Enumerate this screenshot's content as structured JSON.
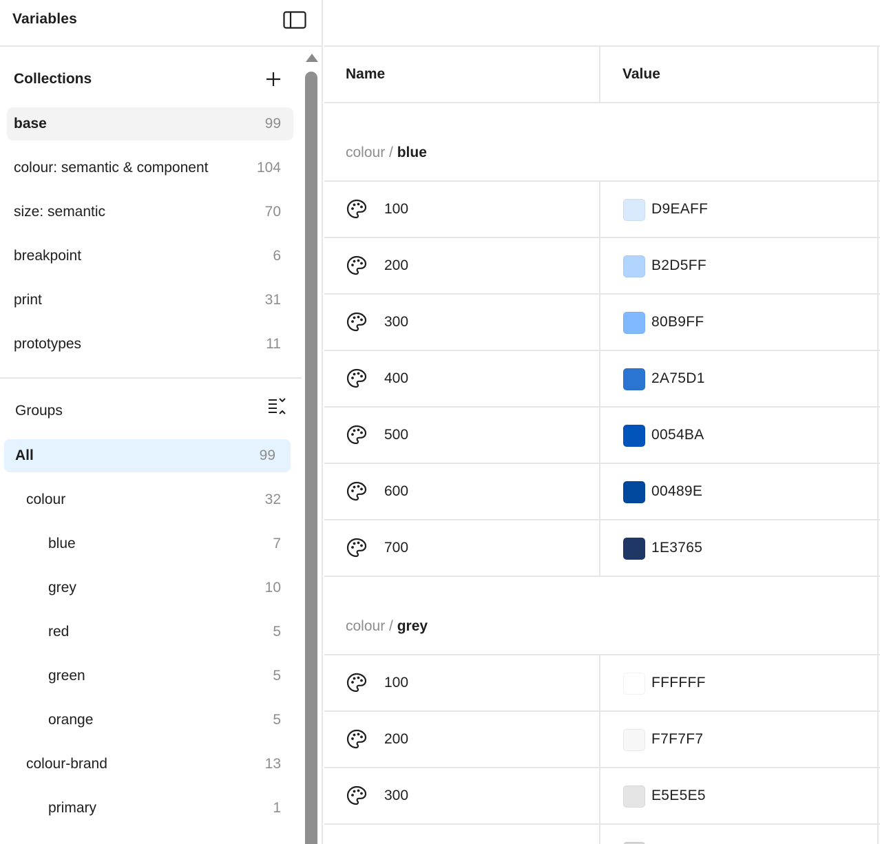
{
  "panel": {
    "title": "Variables"
  },
  "collections": {
    "label": "Collections",
    "items": [
      {
        "label": "base",
        "count": "99"
      },
      {
        "label": "colour: semantic & component",
        "count": "104"
      },
      {
        "label": "size: semantic",
        "count": "70"
      },
      {
        "label": "breakpoint",
        "count": "6"
      },
      {
        "label": "print",
        "count": "31"
      },
      {
        "label": "prototypes",
        "count": "11"
      }
    ]
  },
  "groups": {
    "label": "Groups",
    "items": [
      {
        "label": "All",
        "count": "99"
      },
      {
        "label": "colour",
        "count": "32"
      },
      {
        "label": "blue",
        "count": "7"
      },
      {
        "label": "grey",
        "count": "10"
      },
      {
        "label": "red",
        "count": "5"
      },
      {
        "label": "green",
        "count": "5"
      },
      {
        "label": "orange",
        "count": "5"
      },
      {
        "label": "colour-brand",
        "count": "13"
      },
      {
        "label": "primary",
        "count": "1"
      }
    ]
  },
  "table": {
    "name_header": "Name",
    "value_header": "Value",
    "groups": [
      {
        "path": "colour / ",
        "name": "blue",
        "rows": [
          {
            "name": "100",
            "value": "D9EAFF",
            "color": "#D9EAFF"
          },
          {
            "name": "200",
            "value": "B2D5FF",
            "color": "#B2D5FF"
          },
          {
            "name": "300",
            "value": "80B9FF",
            "color": "#80B9FF"
          },
          {
            "name": "400",
            "value": "2A75D1",
            "color": "#2A75D1"
          },
          {
            "name": "500",
            "value": "0054BA",
            "color": "#0054BA"
          },
          {
            "name": "600",
            "value": "00489E",
            "color": "#00489E"
          },
          {
            "name": "700",
            "value": "1E3765",
            "color": "#1E3765"
          }
        ]
      },
      {
        "path": "colour / ",
        "name": "grey",
        "rows": [
          {
            "name": "100",
            "value": "FFFFFF",
            "color": "#FFFFFF"
          },
          {
            "name": "200",
            "value": "F7F7F7",
            "color": "#F7F7F7"
          },
          {
            "name": "300",
            "value": "E5E5E5",
            "color": "#E5E5E5"
          }
        ]
      }
    ]
  }
}
